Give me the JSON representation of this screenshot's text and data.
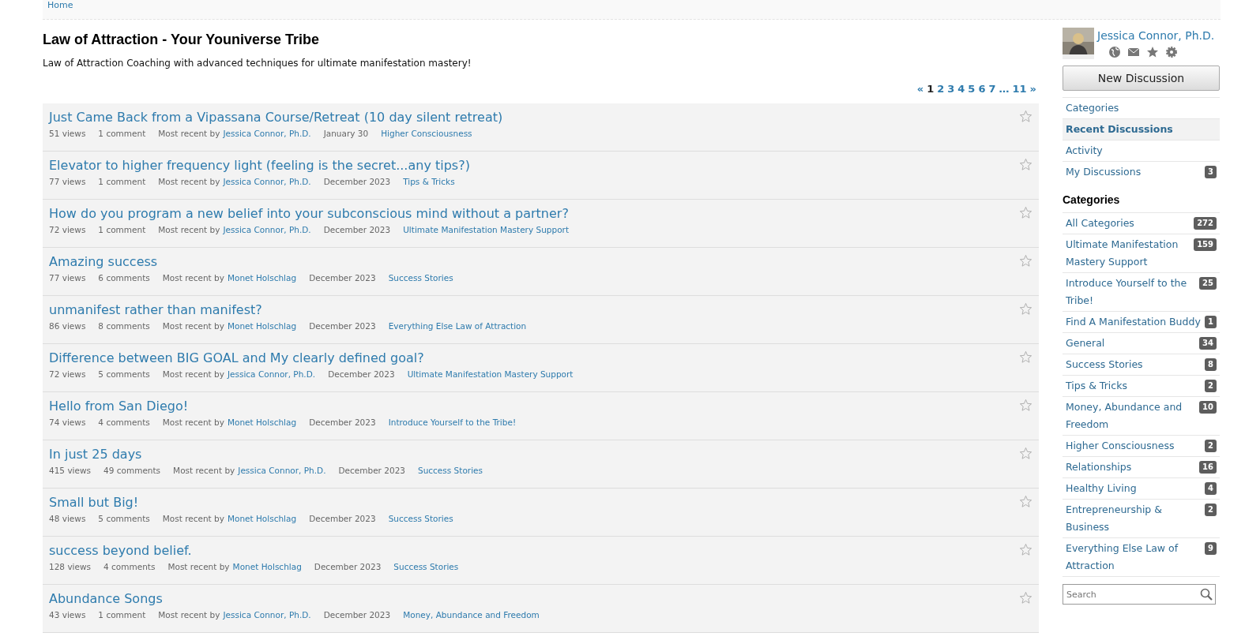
{
  "breadcrumb": [
    "Home"
  ],
  "title": "Law of Attraction - Your Youniverse Tribe",
  "description": "Law of Attraction Coaching with advanced techniques for ultimate manifestation mastery!",
  "pager": {
    "prev": "«",
    "next": "»",
    "pages": [
      {
        "label": "1",
        "selected": true
      },
      {
        "label": "2",
        "selected": false
      },
      {
        "label": "3",
        "selected": false
      },
      {
        "label": "4",
        "selected": false
      },
      {
        "label": "5",
        "selected": false
      },
      {
        "label": "6",
        "selected": false
      },
      {
        "label": "7",
        "selected": false
      },
      {
        "label": "…",
        "selected": false
      },
      {
        "label": "11",
        "selected": false
      }
    ]
  },
  "discussions": [
    {
      "title": "Just Came Back from a Vipassana Course/Retreat (10 day silent retreat)",
      "views": "51 views",
      "comments": "1 comment",
      "recent_label": "Most recent by",
      "author": "Jessica Connor, Ph.D.",
      "date": "January 30",
      "category": "Higher Consciousness",
      "bookmarked": false
    },
    {
      "title": "Elevator to higher frequency light (feeling is the secret...any tips?)",
      "views": "77 views",
      "comments": "1 comment",
      "recent_label": "Most recent by",
      "author": "Jessica Connor, Ph.D.",
      "date": "December 2023",
      "category": "Tips & Tricks",
      "bookmarked": false
    },
    {
      "title": "How do you program a new belief into your subconscious mind without a partner?",
      "views": "72 views",
      "comments": "1 comment",
      "recent_label": "Most recent by",
      "author": "Jessica Connor, Ph.D.",
      "date": "December 2023",
      "category": "Ultimate Manifestation Mastery Support",
      "bookmarked": false
    },
    {
      "title": "Amazing success",
      "views": "77 views",
      "comments": "6 comments",
      "recent_label": "Most recent by",
      "author": "Monet Holschlag",
      "date": "December 2023",
      "category": "Success Stories",
      "bookmarked": false
    },
    {
      "title": "unmanifest rather than manifest?",
      "views": "86 views",
      "comments": "8 comments",
      "recent_label": "Most recent by",
      "author": "Monet Holschlag",
      "date": "December 2023",
      "category": "Everything Else Law of Attraction",
      "bookmarked": false
    },
    {
      "title": "Difference between BIG GOAL and My clearly defined goal?",
      "views": "72 views",
      "comments": "5 comments",
      "recent_label": "Most recent by",
      "author": "Jessica Connor, Ph.D.",
      "date": "December 2023",
      "category": "Ultimate Manifestation Mastery Support",
      "bookmarked": false
    },
    {
      "title": "Hello from San Diego!",
      "views": "74 views",
      "comments": "4 comments",
      "recent_label": "Most recent by",
      "author": "Monet Holschlag",
      "date": "December 2023",
      "category": "Introduce Yourself to the Tribe!",
      "bookmarked": false
    },
    {
      "title": "In just 25 days",
      "views": "415 views",
      "comments": "49 comments",
      "recent_label": "Most recent by",
      "author": "Jessica Connor, Ph.D.",
      "date": "December 2023",
      "category": "Success Stories",
      "bookmarked": false
    },
    {
      "title": "Small but Big!",
      "views": "48 views",
      "comments": "5 comments",
      "recent_label": "Most recent by",
      "author": "Monet Holschlag",
      "date": "December 2023",
      "category": "Success Stories",
      "bookmarked": false
    },
    {
      "title": "success beyond belief.",
      "views": "128 views",
      "comments": "4 comments",
      "recent_label": "Most recent by",
      "author": "Monet Holschlag",
      "date": "December 2023",
      "category": "Success Stories",
      "bookmarked": false
    },
    {
      "title": "Abundance Songs",
      "views": "43 views",
      "comments": "1 comment",
      "recent_label": "Most recent by",
      "author": "Jessica Connor, Ph.D.",
      "date": "December 2023",
      "category": "Money, Abundance and Freedom",
      "bookmarked": false
    }
  ],
  "sidebar": {
    "user": {
      "name": "Jessica Connor, Ph.D."
    },
    "new_button": "New Discussion",
    "nav": [
      {
        "label": "Categories",
        "selected": false
      },
      {
        "label": "Recent Discussions",
        "selected": true
      },
      {
        "label": "Activity",
        "selected": false
      },
      {
        "label": "My Discussions",
        "count": "3",
        "selected": false
      }
    ],
    "categories_heading": "Categories",
    "categories": [
      {
        "label": "All Categories",
        "count": "272"
      },
      {
        "label": "Ultimate Manifestation Mastery Support",
        "count": "159"
      },
      {
        "label": "Introduce Yourself to the Tribe!",
        "count": "25"
      },
      {
        "label": "Find A Manifestation Buddy",
        "count": "1"
      },
      {
        "label": "General",
        "count": "34"
      },
      {
        "label": "Success Stories",
        "count": "8"
      },
      {
        "label": "Tips & Tricks",
        "count": "2"
      },
      {
        "label": "Money, Abundance and Freedom",
        "count": "10"
      },
      {
        "label": "Higher Consciousness",
        "count": "2"
      },
      {
        "label": "Relationships",
        "count": "16"
      },
      {
        "label": "Healthy Living",
        "count": "4"
      },
      {
        "label": "Entrepreneurship & Business",
        "count": "2"
      },
      {
        "label": "Everything Else Law of Attraction",
        "count": "9"
      }
    ],
    "search": {
      "placeholder": "Search"
    }
  }
}
